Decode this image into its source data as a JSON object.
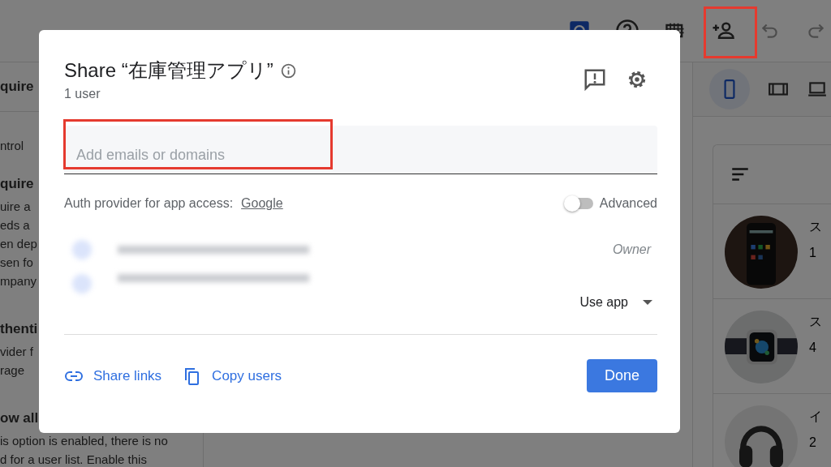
{
  "background": {
    "sections": [
      {
        "heading": "quire"
      },
      {
        "lines": [
          "ntrol"
        ]
      },
      {
        "heading": "quire",
        "lines": [
          "uire a",
          "eds a",
          "en dep",
          "sen fo",
          "mpany"
        ]
      },
      {
        "heading": "thenti",
        "lines": [
          "vider f",
          "rage"
        ]
      },
      {
        "heading": "ow all",
        "lines": [
          "is option is enabled, there is no",
          "d for a user list. Enable this"
        ]
      }
    ],
    "items": [
      {
        "title": "ス",
        "count": "1",
        "kind": "picture"
      },
      {
        "title": "ス",
        "count": "4",
        "kind": "picture"
      },
      {
        "title": "イ",
        "count": "2",
        "kind": "picture"
      }
    ]
  },
  "dialog": {
    "title": "Share “在庫管理アプリ”",
    "subtitle": "1 user",
    "field": {
      "placeholder": "Add emails or domains"
    },
    "auth": {
      "label": "Auth provider for app access:",
      "link": "Google"
    },
    "advanced": {
      "label": "Advanced",
      "on": false
    },
    "users": [
      {
        "kind": "role",
        "role": "Owner"
      },
      {
        "kind": "dropdown",
        "access": "Use app"
      }
    ],
    "links": [
      {
        "kind": "link",
        "label": "Share links"
      },
      {
        "kind": "copy",
        "label": "Copy users"
      }
    ],
    "done": "Done"
  }
}
